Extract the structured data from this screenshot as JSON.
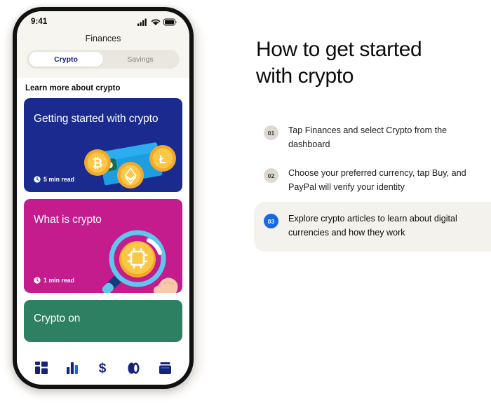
{
  "phone": {
    "status": {
      "time": "9:41",
      "signal_icon": "cellular-signal-icon",
      "wifi_icon": "wifi-icon",
      "battery_icon": "battery-icon"
    },
    "title": "Finances",
    "tabs": [
      {
        "label": "Crypto",
        "active": true
      },
      {
        "label": "Savings",
        "active": false
      }
    ],
    "section_title": "Learn more about crypto",
    "cards": [
      {
        "title": "Getting started\nwith crypto",
        "read_time": "5 min read",
        "bg": "#1b2a8f",
        "illustration": "crypto-wallet-coins-illustration",
        "coins": [
          "bitcoin",
          "litecoin",
          "ethereum"
        ]
      },
      {
        "title": "What is crypto",
        "read_time": "1 min read",
        "bg": "#c41b8d",
        "illustration": "magnifying-glass-coin-illustration"
      },
      {
        "title": "Crypto on",
        "read_time": "",
        "bg": "#2e8062",
        "illustration": ""
      }
    ],
    "nav": [
      {
        "icon": "dashboard-grid-icon",
        "active": false
      },
      {
        "icon": "bar-chart-icon",
        "active": true
      },
      {
        "icon": "dollar-sign-icon",
        "active": false
      },
      {
        "icon": "coins-icon",
        "active": false
      },
      {
        "icon": "wallet-icon",
        "active": false
      }
    ]
  },
  "panel": {
    "title": "How to get started\nwith crypto",
    "steps": [
      {
        "number": "01",
        "text": "Tap Finances and select Crypto from the dashboard",
        "highlight": false
      },
      {
        "number": "02",
        "text": "Choose your preferred currency, tap Buy, and PayPal will verify your identity",
        "highlight": false
      },
      {
        "number": "03",
        "text": "Explore crypto articles to learn about digital currencies and how they work",
        "highlight": true
      }
    ]
  },
  "colors": {
    "accent_blue": "#1668e3",
    "card_blue": "#1b2a8f",
    "card_pink": "#c41b8d",
    "card_green": "#2e8062",
    "highlight_bg": "#f4f2ed",
    "cream": "#f7f5f0"
  }
}
